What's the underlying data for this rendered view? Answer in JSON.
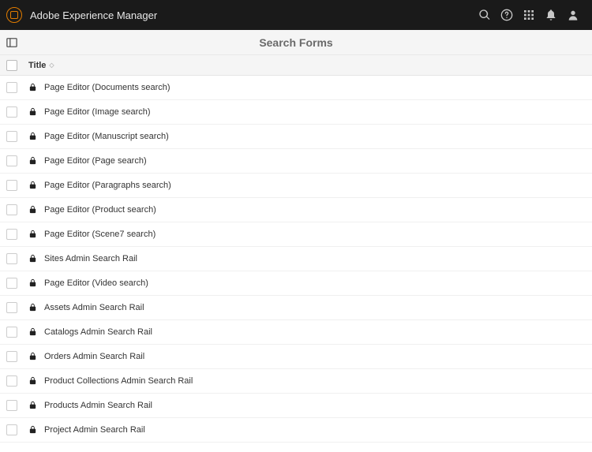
{
  "header": {
    "brand": "Adobe Experience Manager"
  },
  "page": {
    "title": "Search Forms",
    "column_title": "Title"
  },
  "rows": [
    {
      "title": "Page Editor (Documents search)"
    },
    {
      "title": "Page Editor (Image search)"
    },
    {
      "title": "Page Editor (Manuscript search)"
    },
    {
      "title": "Page Editor (Page search)"
    },
    {
      "title": "Page Editor (Paragraphs search)"
    },
    {
      "title": "Page Editor (Product search)"
    },
    {
      "title": "Page Editor (Scene7 search)"
    },
    {
      "title": "Sites Admin Search Rail"
    },
    {
      "title": "Page Editor (Video search)"
    },
    {
      "title": "Assets Admin Search Rail"
    },
    {
      "title": "Catalogs Admin Search Rail"
    },
    {
      "title": "Orders Admin Search Rail"
    },
    {
      "title": "Product Collections Admin Search Rail"
    },
    {
      "title": "Products Admin Search Rail"
    },
    {
      "title": "Project Admin Search Rail"
    }
  ]
}
